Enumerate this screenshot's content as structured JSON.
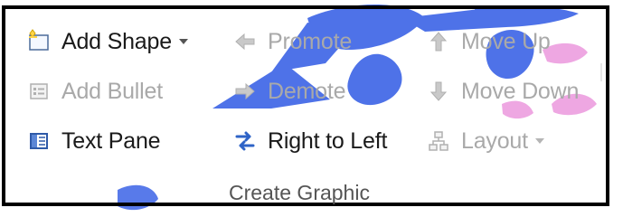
{
  "ribbon": {
    "group_label": "Create Graphic",
    "buttons": {
      "add_shape": {
        "label": "Add Shape",
        "icon": "add-shape-icon",
        "enabled": true,
        "has_dropdown": true
      },
      "add_bullet": {
        "label": "Add Bullet",
        "icon": "add-bullet-icon",
        "enabled": false
      },
      "text_pane": {
        "label": "Text Pane",
        "icon": "text-pane-icon",
        "enabled": true
      },
      "promote": {
        "label": "Promote",
        "icon": "promote-arrow-icon",
        "enabled": false
      },
      "demote": {
        "label": "Demote",
        "icon": "demote-arrow-icon",
        "enabled": false
      },
      "right_to_left": {
        "label": "Right to Left",
        "icon": "right-to-left-icon",
        "enabled": true
      },
      "move_up": {
        "label": "Move Up",
        "icon": "move-up-icon",
        "enabled": false
      },
      "move_down": {
        "label": "Move Down",
        "icon": "move-down-icon",
        "enabled": false
      },
      "layout": {
        "label": "Layout",
        "icon": "layout-icon",
        "enabled": false,
        "has_dropdown": true
      }
    }
  },
  "colors": {
    "enabled_text": "#1a1a1a",
    "disabled_text": "#a9a9a9",
    "frame": "#000000",
    "watermark_blue": "#3b63e6",
    "watermark_pink": "#e98ad9"
  }
}
